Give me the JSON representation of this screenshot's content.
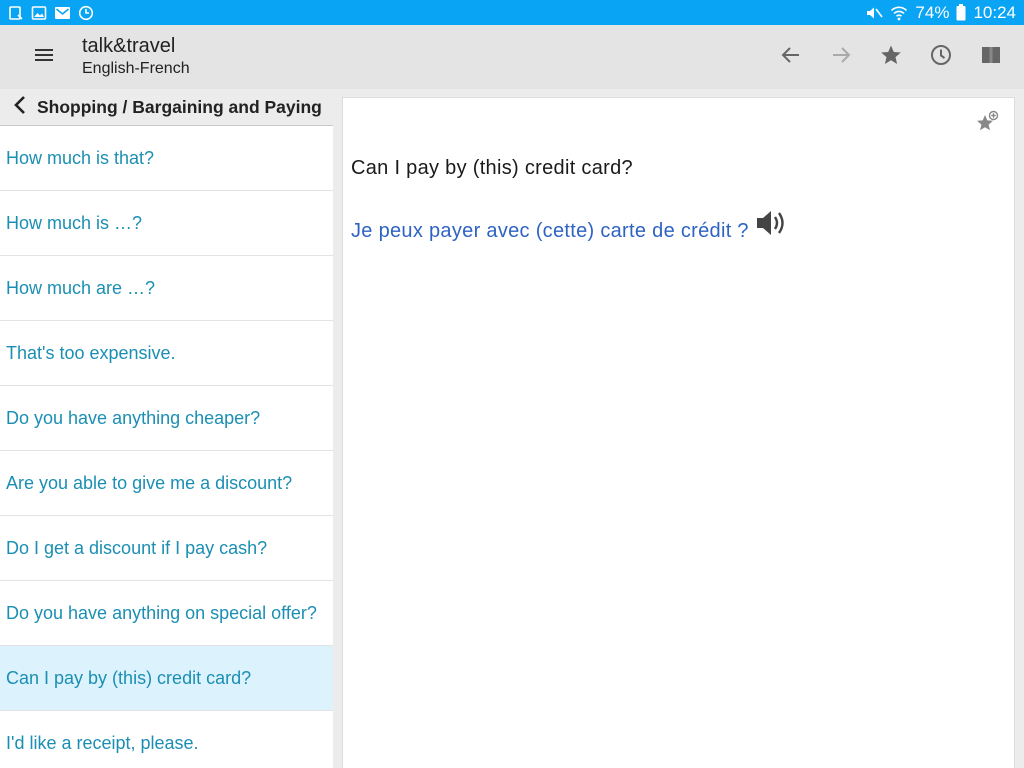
{
  "status_bar": {
    "battery": "74%",
    "time": "10:24",
    "icons_left": [
      "notification-icon",
      "gallery-icon",
      "gmail-icon",
      "sync-icon"
    ],
    "icons_right": [
      "mute-icon",
      "wifi-icon",
      "battery-icon"
    ]
  },
  "app_bar": {
    "title": "talk&travel",
    "subtitle": "English-French",
    "actions": [
      "back-arrow-icon",
      "forward-arrow-icon",
      "star-icon",
      "history-icon",
      "book-icon"
    ]
  },
  "left_panel": {
    "breadcrumb": "Shopping / Bargaining and Paying",
    "phrases": [
      "How much is that?",
      "How much is …?",
      "How much are …?",
      "That's too expensive.",
      "Do you have anything cheaper?",
      "Are you able to give me a discount?",
      "Do I get a discount if I pay cash?",
      "Do you have anything on special offer?",
      "Can I pay by (this) credit card?",
      "I'd like a receipt, please."
    ],
    "selected_index": 8
  },
  "detail": {
    "source": "Can I pay by (this) credit card?",
    "translation": "Je peux payer avec (cette) carte de crédit ?"
  },
  "colors": {
    "status_bar": "#0aa4f5",
    "app_bar": "#e4e4e4",
    "phrase_link": "#1b8fb3",
    "selected_row": "#dcf3fd",
    "translation": "#2f63c2"
  }
}
